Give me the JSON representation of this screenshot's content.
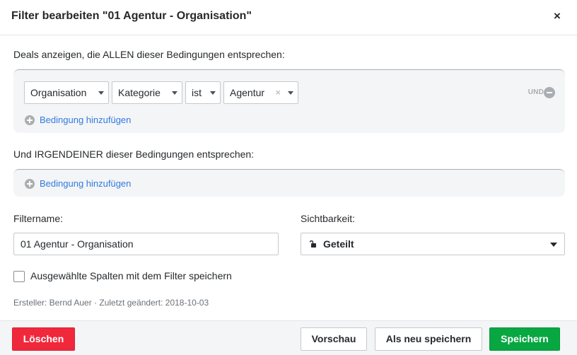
{
  "dialog": {
    "title": "Filter bearbeiten \"01 Agentur - Organisation\"",
    "close_label": "×"
  },
  "all_conditions": {
    "label": "Deals anzeigen, die ALLEN dieser Bedingungen entsprechen:",
    "row": {
      "entity": "Organisation",
      "field": "Kategorie",
      "operator": "ist",
      "value": "Agentur",
      "value_clear": "×",
      "connector": "UND"
    },
    "add_label": "Bedingung hinzufügen"
  },
  "any_conditions": {
    "label": "Und IRGENDEINER dieser Bedingungen entsprechen:",
    "add_label": "Bedingung hinzufügen"
  },
  "filter_name": {
    "label": "Filtername:",
    "value": "01 Agentur - Organisation"
  },
  "visibility": {
    "label": "Sichtbarkeit:",
    "value": "Geteilt",
    "icon": "unlock-icon"
  },
  "save_columns": {
    "label": "Ausgewählte Spalten mit dem Filter speichern",
    "checked": false
  },
  "meta": "Ersteller: Bernd Auer · Zuletzt geändert: 2018-10-03",
  "buttons": {
    "delete": "Löschen",
    "preview": "Vorschau",
    "save_as_new": "Als neu speichern",
    "save": "Speichern"
  },
  "colors": {
    "danger": "#f0283c",
    "success": "#08a742",
    "link": "#317ae2"
  }
}
